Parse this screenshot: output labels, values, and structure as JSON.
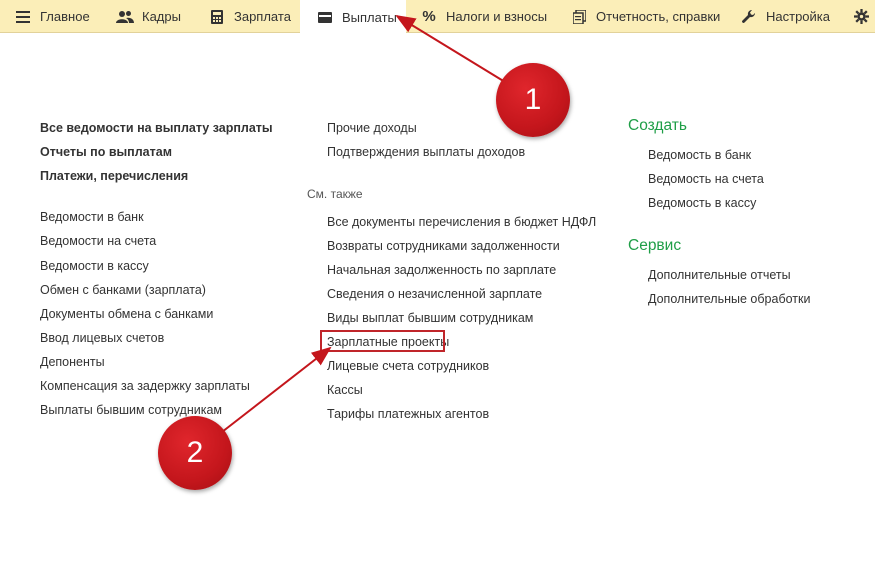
{
  "menu": {
    "tabs": [
      {
        "label": "Главное",
        "icon": "hamburger-icon"
      },
      {
        "label": "Кадры",
        "icon": "people-icon"
      },
      {
        "label": "Зарплата",
        "icon": "calculator-icon"
      },
      {
        "label": "Выплаты",
        "icon": "wallet-icon",
        "active": true
      },
      {
        "label": "Налоги и взносы",
        "icon": "percent-icon"
      },
      {
        "label": "Отчетность, справки",
        "icon": "documents-icon"
      },
      {
        "label": "Настройка",
        "icon": "wrench-icon"
      },
      {
        "label": "",
        "icon": "gear-icon"
      }
    ]
  },
  "col1": {
    "bold_links": [
      "Все ведомости на выплату зарплаты",
      "Отчеты по выплатам",
      "Платежи, перечисления"
    ],
    "links": [
      "Ведомости в банк",
      "Ведомости на счета",
      "Ведомости в кассу",
      "Обмен с банками (зарплата)",
      "Документы обмена с банками",
      "Ввод лицевых счетов",
      "Депоненты",
      "Компенсация за задержку зарплаты",
      "Выплаты бывшим сотрудникам"
    ]
  },
  "col2": {
    "links_top": [
      "Прочие доходы",
      "Подтверждения выплаты доходов"
    ],
    "see_also_label": "См. также",
    "see_also": [
      "Все документы перечисления в бюджет НДФЛ",
      "Возвраты сотрудниками задолженности",
      "Начальная задолженность по зарплате",
      "Сведения о незачисленной зарплате",
      "Виды выплат бывшим сотрудникам",
      "Зарплатные проекты",
      "Лицевые счета сотрудников",
      "Кассы",
      "Тарифы платежных агентов"
    ]
  },
  "col3": {
    "create_title": "Создать",
    "create_links": [
      "Ведомость в банк",
      "Ведомость на счета",
      "Ведомость в кассу"
    ],
    "service_title": "Сервис",
    "service_links": [
      "Дополнительные отчеты",
      "Дополнительные обработки"
    ]
  },
  "annotations": {
    "badge1": "1",
    "badge2": "2",
    "accent_color": "#c4161c"
  }
}
